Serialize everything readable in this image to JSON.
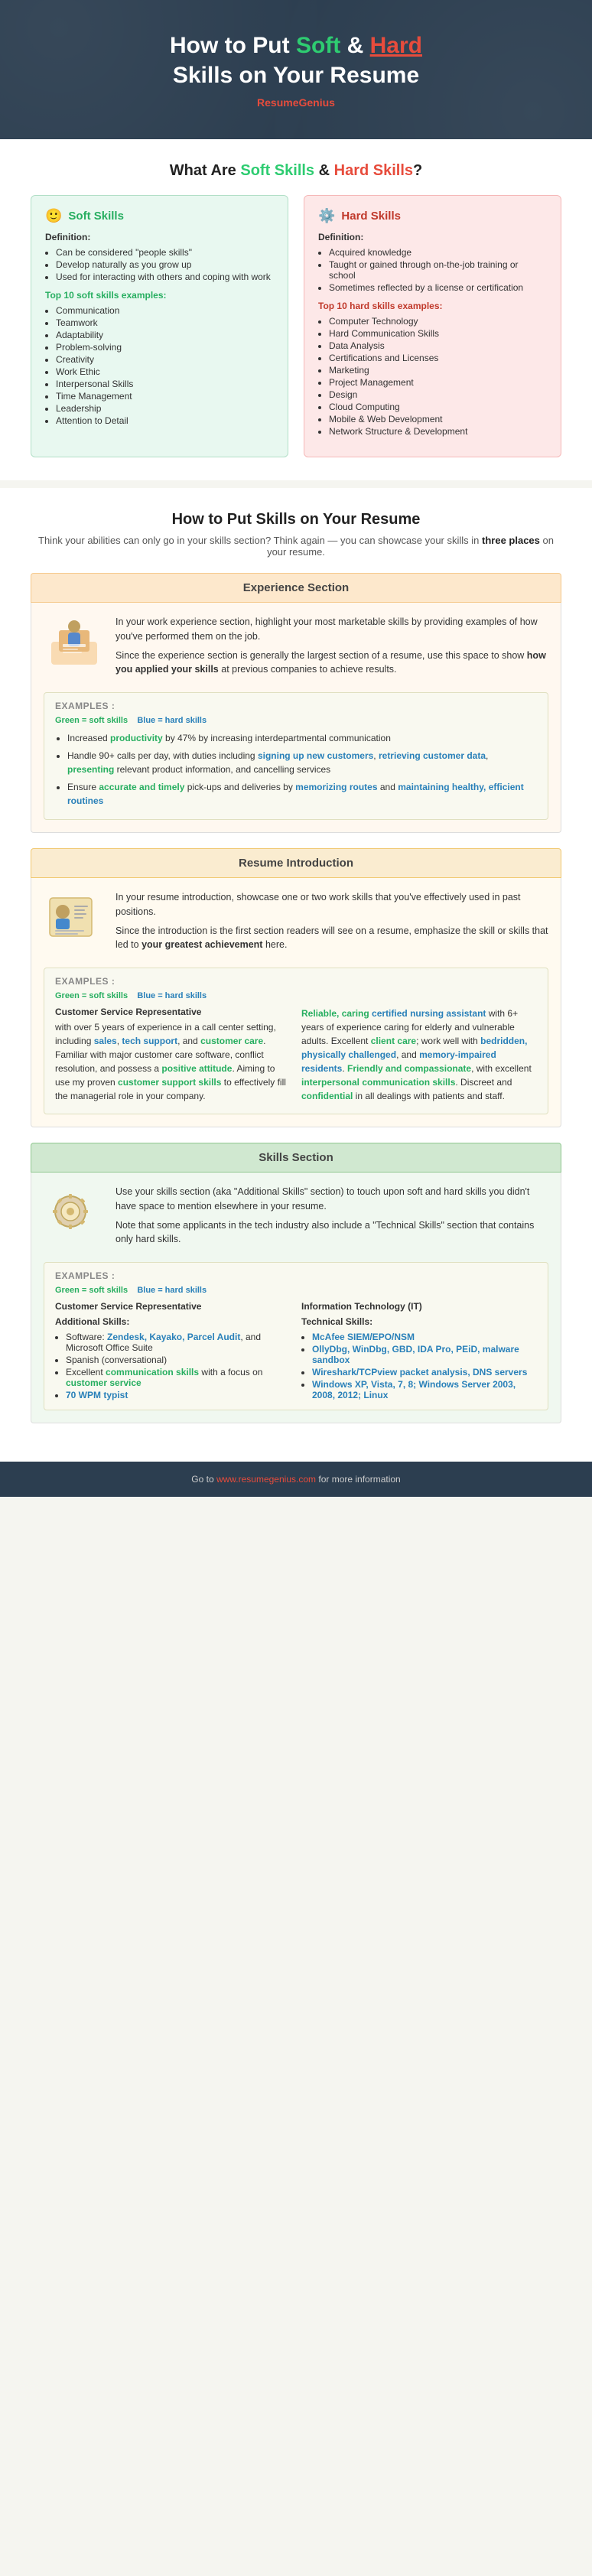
{
  "header": {
    "title_pre": "How to Put ",
    "title_soft": "Soft",
    "title_mid": " & ",
    "title_hard": "Hard",
    "title_post": "",
    "title_line2": "Skills on Your Resume",
    "brand_pre": "Resume",
    "brand_bold": "Genius"
  },
  "what_section": {
    "heading_pre": "What Are ",
    "heading_soft": "Soft Skills",
    "heading_mid": " & ",
    "heading_hard": "Hard Skills",
    "heading_post": "?",
    "soft_skills": {
      "icon": "🙂",
      "title": "Soft Skills",
      "definition_label": "Definition:",
      "bullets": [
        "Can be considered \"people skills\"",
        "Develop naturally as you grow up",
        "Used for interacting with others and coping with work"
      ],
      "top_label": "Top 10 soft skills examples:",
      "examples": [
        "Communication",
        "Teamwork",
        "Adaptability",
        "Problem-solving",
        "Creativity",
        "Work Ethic",
        "Interpersonal Skills",
        "Time Management",
        "Leadership",
        "Attention to Detail"
      ]
    },
    "hard_skills": {
      "icon": "⚙️",
      "title": "Hard Skills",
      "definition_label": "Definition:",
      "bullets": [
        "Acquired knowledge",
        "Taught or gained through on-the-job training or school",
        "Sometimes reflected by a license or certification"
      ],
      "top_label": "Top 10 hard skills examples:",
      "examples": [
        "Computer Technology",
        "Hard Communication Skills",
        "Data Analysis",
        "Certifications and Licenses",
        "Marketing",
        "Project Management",
        "Design",
        "Cloud Computing",
        "Mobile & Web Development",
        "Network Structure & Development"
      ]
    }
  },
  "how_section": {
    "heading": "How to Put Skills on Your Resume",
    "subtitle": "Think your abilities can only go in your skills section? Think again — you can showcase your skills in",
    "subtitle_bold": "three places",
    "subtitle_post": "on your resume.",
    "experience": {
      "header": "Experience Section",
      "body_p1": "In your work experience section, highlight your most marketable skills by providing examples of how you've performed them on the job.",
      "body_p2": "Since the experience section is generally the largest section of a resume, use this space to show how you applied your skills at previous companies to achieve results.",
      "examples_label": "EXAMPLES :",
      "legend_green": "Green = soft skills",
      "legend_blue": "Blue = hard skills",
      "bullets": [
        {
          "parts": [
            {
              "text": "Increased ",
              "style": "normal"
            },
            {
              "text": "productivity",
              "style": "green"
            },
            {
              "text": " by 47% by increasing interdepartmental communication",
              "style": "normal"
            }
          ]
        },
        {
          "parts": [
            {
              "text": "Handle 90+ calls per day, with duties including ",
              "style": "normal"
            },
            {
              "text": "signing up new customers",
              "style": "blue"
            },
            {
              "text": ", ",
              "style": "normal"
            },
            {
              "text": "retrieving customer data",
              "style": "blue"
            },
            {
              "text": ", ",
              "style": "normal"
            },
            {
              "text": "presenting",
              "style": "green"
            },
            {
              "text": " relevant product information, and cancelling services",
              "style": "normal"
            }
          ]
        },
        {
          "parts": [
            {
              "text": "Ensure ",
              "style": "normal"
            },
            {
              "text": "accurate and timely",
              "style": "green"
            },
            {
              "text": " pick-ups and deliveries by ",
              "style": "normal"
            },
            {
              "text": "memorizing routes",
              "style": "blue"
            },
            {
              "text": " and ",
              "style": "normal"
            },
            {
              "text": "maintaining healthy, efficient routines",
              "style": "blue"
            }
          ]
        }
      ]
    },
    "introduction": {
      "header": "Resume Introduction",
      "body_p1": "In your resume introduction, showcase one or two work skills that you've effectively used in past positions.",
      "body_p2": "Since the introduction is the first section readers will see on a resume, emphasize the skill or skills that led to your greatest achievement here.",
      "examples_label": "EXAMPLES :",
      "legend_green": "Green = soft skills",
      "legend_blue": "Blue = hard skills",
      "left_col": {
        "title": "Customer Service Representative",
        "text": "with over 5 years of experience in a call center setting, including",
        "text_parts": [
          {
            "text": "with over 5 years of experience in a call center setting, including ",
            "style": "normal"
          },
          {
            "text": "sales",
            "style": "blue"
          },
          {
            "text": ", ",
            "style": "normal"
          },
          {
            "text": "tech support",
            "style": "blue"
          },
          {
            "text": ", and ",
            "style": "normal"
          },
          {
            "text": "customer care",
            "style": "green"
          },
          {
            "text": ". Familiar with major customer care software, conflict resolution, and possess a ",
            "style": "normal"
          },
          {
            "text": "positive attitude",
            "style": "green"
          },
          {
            "text": ". Aiming to use my proven ",
            "style": "normal"
          },
          {
            "text": "customer support skills",
            "style": "green"
          },
          {
            "text": " to effectively fill the managerial role in your company.",
            "style": "normal"
          }
        ]
      },
      "right_col": {
        "title": "Reliable, caring certified nursing assistant",
        "text_parts": [
          {
            "text": "Reliable, caring ",
            "style": "green"
          },
          {
            "text": "certified nursing assistant",
            "style": "blue"
          },
          {
            "text": " with 6+ years of experience caring for elderly and vulnerable adults. Excellent ",
            "style": "normal"
          },
          {
            "text": "client care",
            "style": "green"
          },
          {
            "text": "; work well with ",
            "style": "normal"
          },
          {
            "text": "bedridden, physically challenged",
            "style": "blue"
          },
          {
            "text": ", and ",
            "style": "normal"
          },
          {
            "text": "memory-impaired residents",
            "style": "blue"
          },
          {
            "text": ". Friendly and ",
            "style": "normal"
          },
          {
            "text": "compassionate",
            "style": "green"
          },
          {
            "text": ", with excellent ",
            "style": "normal"
          },
          {
            "text": "interpersonal communication skills",
            "style": "green"
          },
          {
            "text": ". Discreet and ",
            "style": "normal"
          },
          {
            "text": "confidential",
            "style": "green"
          },
          {
            "text": " in all dealings with patients and staff.",
            "style": "normal"
          }
        ]
      }
    },
    "skills_section": {
      "header": "Skills Section",
      "body_p1": "Use your skills section (aka \"Additional Skills\" section) to touch upon soft and hard skills you didn't have space to mention elsewhere in your resume.",
      "body_p2": "Note that some applicants in the tech industry also include a \"Technical Skills\" section that contains only hard skills.",
      "examples_label": "EXAMPLES :",
      "legend_green": "Green = soft skills",
      "legend_blue": "Blue = hard skills",
      "left_col": {
        "title": "Customer Service Representative",
        "additional_label": "Additional Skills:",
        "bullets": [
          {
            "text_parts": [
              {
                "text": "Software: ",
                "style": "normal"
              },
              {
                "text": "Zendesk, Kayako, Parcel Audit",
                "style": "blue"
              },
              {
                "text": ", and Microsoft Office Suite",
                "style": "normal"
              }
            ]
          },
          {
            "text_parts": [
              {
                "text": "Spanish (conversational)",
                "style": "normal"
              }
            ]
          },
          {
            "text_parts": [
              {
                "text": "Excellent ",
                "style": "normal"
              },
              {
                "text": "communication skills",
                "style": "green"
              },
              {
                "text": " with a focus on ",
                "style": "normal"
              },
              {
                "text": "customer service",
                "style": "green"
              }
            ]
          },
          {
            "text_parts": [
              {
                "text": "70 WPM typist",
                "style": "blue"
              }
            ]
          }
        ]
      },
      "right_col": {
        "title": "Information Technology (IT)",
        "technical_label": "Technical Skills:",
        "bullets": [
          {
            "text_parts": [
              {
                "text": "McAfee SIEM/EPO/NSM",
                "style": "blue"
              }
            ]
          },
          {
            "text_parts": [
              {
                "text": "OllyDbg, WinDbg, GBD, IDA Pro, PEiD, malware sandbox",
                "style": "blue"
              }
            ]
          },
          {
            "text_parts": [
              {
                "text": "Wireshark/TCPview packet analysis, DNS servers",
                "style": "blue"
              }
            ]
          },
          {
            "text_parts": [
              {
                "text": "Windows XP, Vista, 7, 8; Windows Server 2003, 2008, 2012; Linux",
                "style": "blue"
              }
            ]
          }
        ]
      }
    }
  },
  "footer": {
    "text_pre": "Go to ",
    "link": "www.resumegenius.com",
    "text_post": " for more information"
  }
}
